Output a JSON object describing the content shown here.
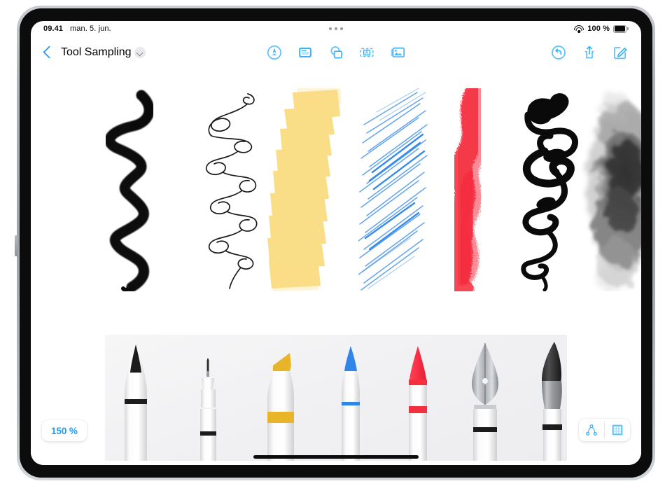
{
  "device": {
    "name": "iPad"
  },
  "status_bar": {
    "time": "09.41",
    "date": "man. 5. jun.",
    "battery_percent": "100 %",
    "wifi_icon": "wifi-icon",
    "battery_icon": "battery-icon",
    "multitask_icon": "multitasking-dots-icon"
  },
  "nav_bar": {
    "back_icon": "back-chevron-icon",
    "title": "Tool Sampling",
    "title_chevron_icon": "chevron-down-icon",
    "center_tools": [
      {
        "name": "draw-tool",
        "icon": "pen-in-circle-icon",
        "label": "Draw"
      },
      {
        "name": "text-tool",
        "icon": "text-note-icon",
        "label": "Text"
      },
      {
        "name": "shapes-tool",
        "icon": "shapes-icon",
        "label": "Shapes"
      },
      {
        "name": "text-box-tool",
        "icon": "text-box-a-icon",
        "label": "Text Box"
      },
      {
        "name": "media-tool",
        "icon": "media-photos-icon",
        "label": "Media"
      }
    ],
    "right_tools": [
      {
        "name": "undo-button",
        "icon": "undo-arrow-icon",
        "label": "Undo"
      },
      {
        "name": "share-button",
        "icon": "share-icon",
        "label": "Share"
      },
      {
        "name": "compose-button",
        "icon": "compose-pencil-icon",
        "label": "Compose"
      }
    ]
  },
  "canvas": {
    "accent_color": "#1f9dfb",
    "background_color": "#ffffff",
    "tray_background": "#f1f1f3",
    "strokes": [
      {
        "name": "stroke-brush-pen",
        "label": "Brush pen squiggle",
        "color": "#0a0a0a"
      },
      {
        "name": "stroke-technical-pen",
        "label": "Technical pen loops",
        "color": "#1a1a1a"
      },
      {
        "name": "stroke-highlighter",
        "label": "Highlighter zigzag",
        "color": "#f7c93e"
      },
      {
        "name": "stroke-pencil",
        "label": "Pencil hatching",
        "color": "#2f86e8"
      },
      {
        "name": "stroke-crayon",
        "label": "Crayon texture",
        "color": "#f42f40"
      },
      {
        "name": "stroke-fountain-pen",
        "label": "Fountain pen calligraphy",
        "color": "#0a0a0a"
      },
      {
        "name": "stroke-watercolor",
        "label": "Watercolor brush blob",
        "color": "#4a4a4a"
      }
    ],
    "tools": [
      {
        "name": "tool-brush-pen",
        "label": "Brush pen",
        "accent": "#1a1a1a"
      },
      {
        "name": "tool-technical-pen",
        "label": "Technical pen",
        "accent": "#1a1a1a"
      },
      {
        "name": "tool-highlighter",
        "label": "Highlighter",
        "accent": "#e9b528"
      },
      {
        "name": "tool-pencil",
        "label": "Pencil",
        "accent": "#2f86e8"
      },
      {
        "name": "tool-crayon",
        "label": "Crayon",
        "accent": "#f42f40"
      },
      {
        "name": "tool-fountain-pen",
        "label": "Fountain pen",
        "accent": "#9b9ea3"
      },
      {
        "name": "tool-watercolor",
        "label": "Watercolor",
        "accent": "#8e9195"
      }
    ]
  },
  "bottom_bar": {
    "zoom_level": "150 %",
    "right_controls": [
      {
        "name": "node-edit-button",
        "icon": "node-path-icon",
        "label": "Edit Nodes",
        "selected": false
      },
      {
        "name": "grid-view-button",
        "icon": "grid-square-icon",
        "label": "Grid",
        "selected": true
      }
    ],
    "home_indicator": "home-indicator"
  }
}
